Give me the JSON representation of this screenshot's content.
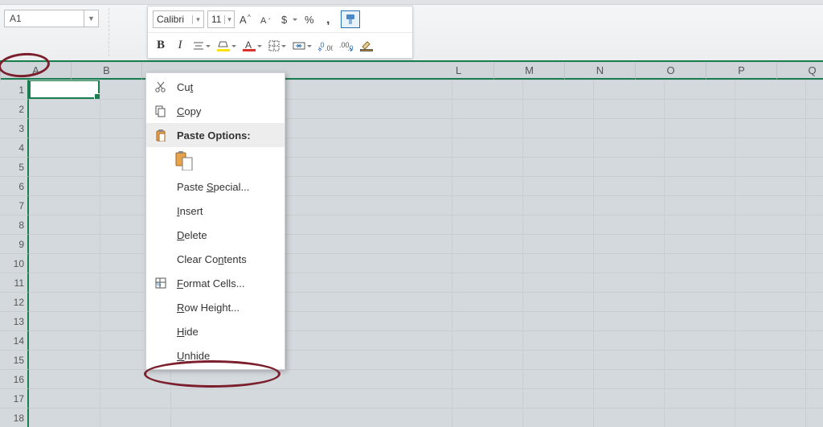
{
  "namebox": {
    "value": "A1"
  },
  "mini_toolbar": {
    "font_name": "Calibri",
    "font_size": "11",
    "row2_bold": "B",
    "row2_italic": "I"
  },
  "columns": [
    "A",
    "B",
    "L",
    "M",
    "N",
    "O",
    "P",
    "Q"
  ],
  "col_gap_after": 1,
  "rows": [
    "1",
    "2",
    "3",
    "4",
    "5",
    "6",
    "7",
    "8",
    "9",
    "10",
    "11",
    "12",
    "13",
    "14",
    "15",
    "16",
    "17",
    "18"
  ],
  "context_menu": {
    "items": [
      {
        "icon": "cut",
        "label": "Cu<u>t</u>"
      },
      {
        "icon": "copy",
        "label": "<u>C</u>opy"
      },
      {
        "icon": "paste",
        "label": "Paste Options:",
        "bold": true,
        "hover": true
      },
      {
        "icon": "paste-sub",
        "sub": true
      },
      {
        "icon": "",
        "label": "Paste <u>S</u>pecial..."
      },
      {
        "icon": "",
        "label": "<u>I</u>nsert"
      },
      {
        "icon": "",
        "label": "<u>D</u>elete"
      },
      {
        "icon": "",
        "label": "Clear Co<u>n</u>tents"
      },
      {
        "icon": "fmt",
        "label": "<u>F</u>ormat Cells..."
      },
      {
        "icon": "",
        "label": "<u>R</u>ow Height..."
      },
      {
        "icon": "",
        "label": "<u>H</u>ide"
      },
      {
        "icon": "",
        "label": "<u>U</u>nhide"
      }
    ]
  }
}
